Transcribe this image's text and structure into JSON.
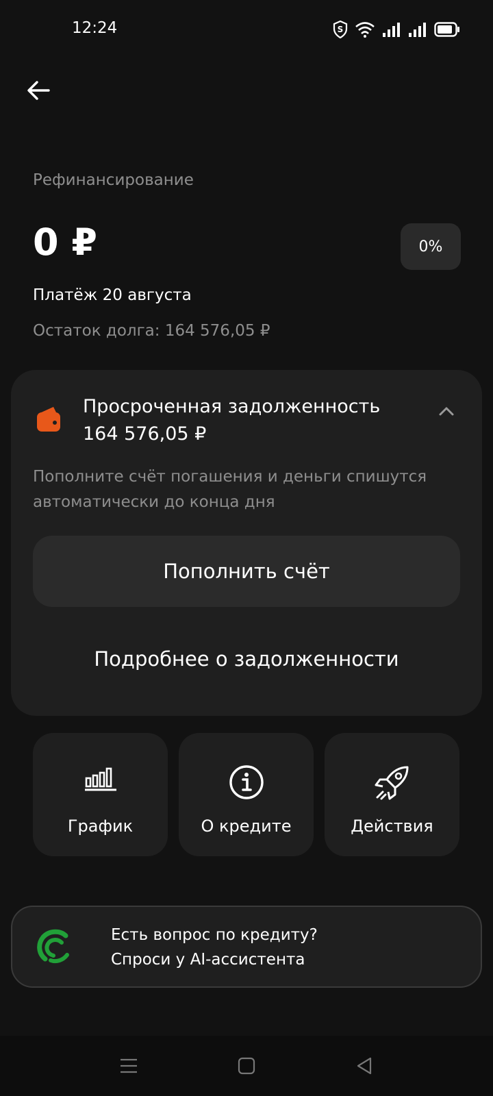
{
  "status_bar": {
    "time": "12:24",
    "icons": [
      "shield-icon",
      "wifi-icon",
      "signal-icon",
      "signal-icon",
      "battery-icon"
    ]
  },
  "header": {
    "back_icon": "arrow-left-icon"
  },
  "loan": {
    "product_name": "Рефинансирование",
    "amount": "0 ₽",
    "rate_badge": "0%",
    "payment_date": "Платёж 20 августа",
    "remaining": "Остаток долга: 164 576,05 ₽"
  },
  "debt_card": {
    "icon": "wallet-icon",
    "title": "Просроченная задолженность",
    "amount": "164 576,05 ₽",
    "collapse_icon": "chevron-up-icon",
    "description": "Пополните счёт погашения и деньги спишутся автоматически до конца дня",
    "topup_label": "Пополнить счёт",
    "details_label": "Подробнее о задолженности",
    "accent_color": "#E8581A"
  },
  "tiles": [
    {
      "label": "График",
      "icon": "bar-chart-icon"
    },
    {
      "label": "О кредите",
      "icon": "info-icon"
    },
    {
      "label": "Действия",
      "icon": "rocket-icon"
    }
  ],
  "ai_banner": {
    "line1": "Есть вопрос по кредиту?",
    "line2": "Спроси у AI-ассистента",
    "logo_icon": "assistant-logo-icon",
    "brand_color": "#21A038"
  },
  "nav_bar": {
    "buttons": [
      "menu-icon",
      "home-icon",
      "back-triangle-icon"
    ]
  }
}
